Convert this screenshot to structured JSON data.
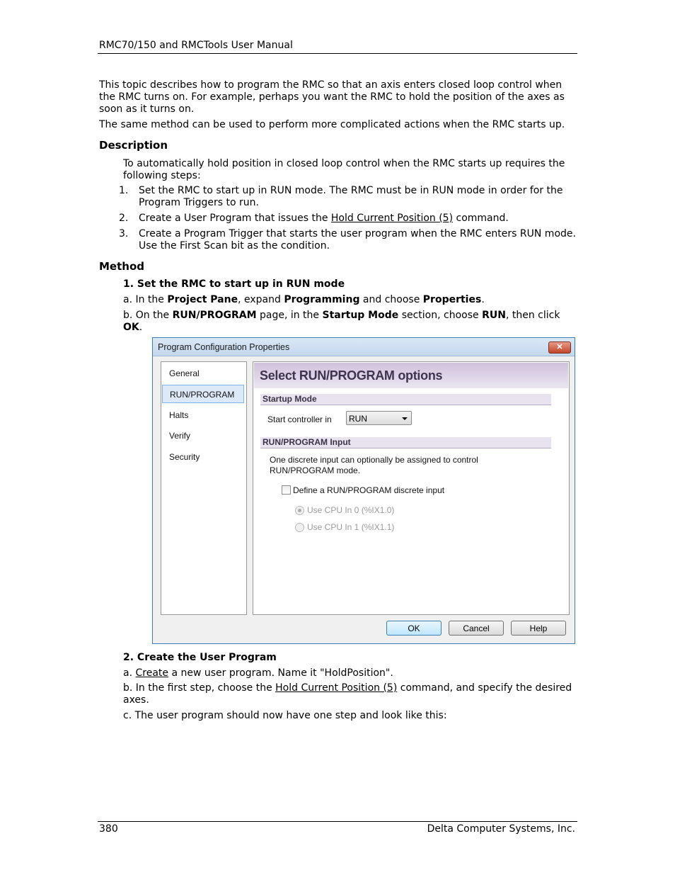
{
  "header": {
    "title": "RMC70/150 and RMCTools User Manual"
  },
  "intro": {
    "p1": "This topic describes how to program the RMC so that an axis enters closed loop control when the RMC turns on. For example, perhaps you want the RMC to hold the position of the axes as soon as it turns on.",
    "p2": "The same method can be used to perform more complicated actions when the RMC starts up."
  },
  "description": {
    "heading": "Description",
    "lead": "To automatically hold position in closed loop control when the RMC starts up requires the following steps:",
    "steps": [
      {
        "num": "1.",
        "text": "Set the RMC to start up in RUN mode. The RMC must be in RUN mode in order for the Program Triggers to run."
      },
      {
        "num": "2.",
        "pre": "Create a User Program that issues the ",
        "link": "Hold Current Position (5)",
        "post": " command."
      },
      {
        "num": "3.",
        "text": "Create a Program Trigger that  starts the user program when the RMC enters RUN mode. Use the First Scan bit as the condition."
      }
    ]
  },
  "method": {
    "heading": "Method",
    "step1": {
      "heading": "1. Set the RMC to start up in RUN mode",
      "a": {
        "prefix": "a.  In the ",
        "b1": "Project Pane",
        "t1": ", expand ",
        "b2": "Programming",
        "t2": " and choose ",
        "b3": "Properties",
        "t3": "."
      },
      "b": {
        "prefix": "b.  On the ",
        "b1": "RUN/PROGRAM",
        "t1": " page, in the ",
        "b2": "Startup Mode",
        "t2": " section, choose ",
        "b3": "RUN",
        "t3": ", then click ",
        "b4": "OK",
        "t4": "."
      }
    },
    "step2": {
      "heading": "2. Create the User Program",
      "a": {
        "prefix": "a.  ",
        "link": "Create",
        "post": " a new user program. Name it \"HoldPosition\"."
      },
      "b": {
        "prefix": "b.  In the first step, choose the ",
        "link": "Hold Current Position (5)",
        "post": " command, and specify the desired axes."
      },
      "c": "c.  The user program should now have one step and look like this:"
    }
  },
  "dialog": {
    "title": "Program Configuration Properties",
    "close_icon": "close-icon",
    "nav": [
      "General",
      "RUN/PROGRAM",
      "Halts",
      "Verify",
      "Security"
    ],
    "selected_nav": "RUN/PROGRAM",
    "panel_title": "Select RUN/PROGRAM options",
    "startup_section": "Startup Mode",
    "start_label": "Start controller in",
    "start_value": "RUN",
    "input_section": "RUN/PROGRAM Input",
    "input_desc1": "One discrete input can optionally be assigned to control",
    "input_desc2": "RUN/PROGRAM mode.",
    "define_checkbox": "Define a RUN/PROGRAM discrete input",
    "define_checked": false,
    "radio0": "Use CPU In 0 (%IX1.0)",
    "radio1": "Use CPU In 1 (%IX1.1)",
    "radio_selected": 0,
    "buttons": {
      "ok": "OK",
      "cancel": "Cancel",
      "help": "Help"
    }
  },
  "footer": {
    "page": "380",
    "company": "Delta Computer Systems, Inc."
  }
}
